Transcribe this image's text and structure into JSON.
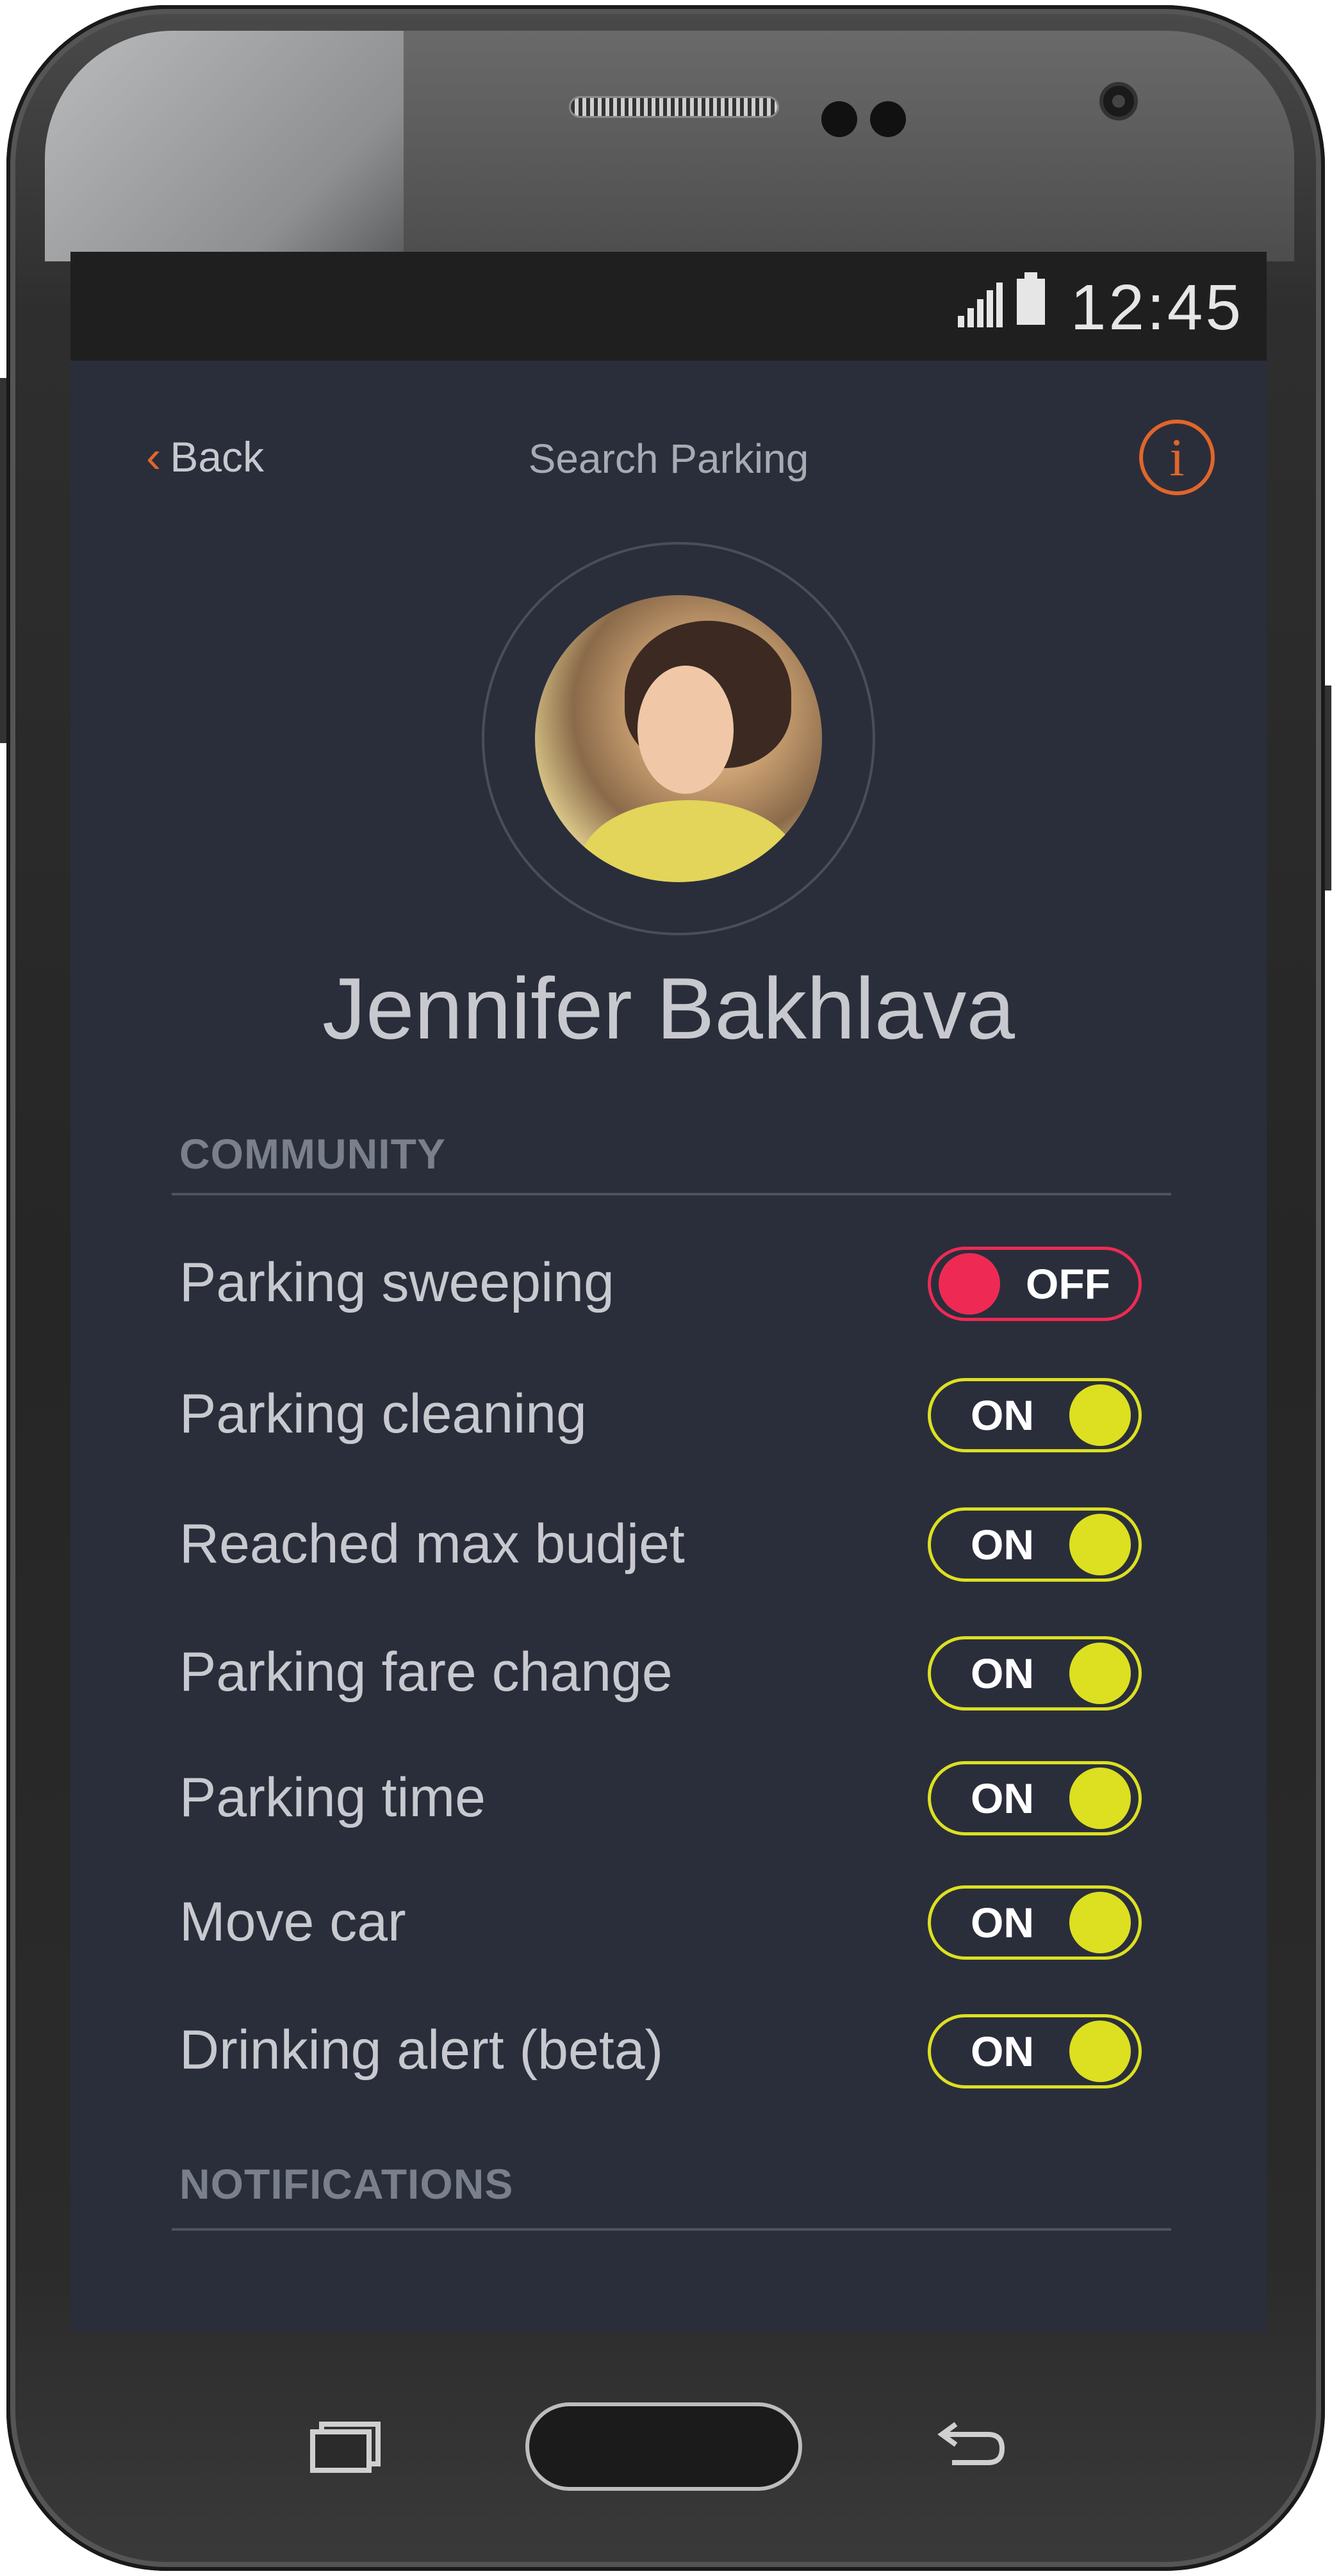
{
  "status_bar": {
    "time": "12:45"
  },
  "top_nav": {
    "back_label": "Back",
    "title": "Search Parking"
  },
  "profile": {
    "name": "Jennifer Bakhlava"
  },
  "sections": {
    "community": "COMMUNITY",
    "notifications": "NOTIFICATIONS"
  },
  "settings": [
    {
      "label": "Parking sweeping",
      "state": "OFF"
    },
    {
      "label": "Parking cleaning",
      "state": "ON"
    },
    {
      "label": "Reached max budjet",
      "state": "ON"
    },
    {
      "label": "Parking fare change",
      "state": "ON"
    },
    {
      "label": "Parking time",
      "state": "ON"
    },
    {
      "label": "Move car",
      "state": "ON"
    },
    {
      "label": "Drinking alert (beta)",
      "state": "ON"
    }
  ],
  "colors": {
    "accent_orange": "#e0662a",
    "on_yellow": "#dde020",
    "off_red": "#ee2a54",
    "background": "#2a2e3b"
  },
  "icons": {
    "back": "chevron-left-icon",
    "info": "info-icon",
    "signal": "signal-icon",
    "battery": "battery-icon"
  }
}
